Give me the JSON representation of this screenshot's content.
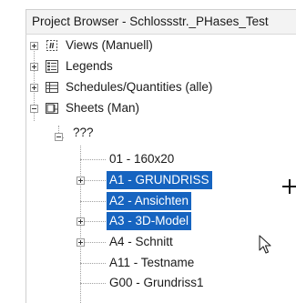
{
  "panel": {
    "title": "Project Browser - Schlossstr._PHases_Test"
  },
  "tree": {
    "views": {
      "label": "Views (Manuell)",
      "icon": "views-icon",
      "expander": "plus"
    },
    "legends": {
      "label": "Legends",
      "icon": "legends-icon",
      "expander": "plus"
    },
    "schedules": {
      "label": "Schedules/Quantities (alle)",
      "icon": "schedules-icon",
      "expander": "plus"
    },
    "sheets": {
      "label": "Sheets (Man)",
      "icon": "sheets-icon",
      "expander": "minus",
      "group": {
        "label": "???",
        "expander": "minus",
        "items": [
          {
            "label": "01 - 160x20",
            "selected": false,
            "expander": "none"
          },
          {
            "label": "A1 - GRUNDRISS",
            "selected": true,
            "expander": "plus"
          },
          {
            "label": "A2 - Ansichten",
            "selected": true,
            "expander": "none"
          },
          {
            "label": "A3 - 3D-Model",
            "selected": true,
            "expander": "plus"
          },
          {
            "label": "A4 - Schnitt",
            "selected": false,
            "expander": "plus"
          },
          {
            "label": "A11 - Testname",
            "selected": false,
            "expander": "none"
          },
          {
            "label": "G00 - Grundriss1",
            "selected": false,
            "expander": "none"
          }
        ]
      }
    }
  },
  "colors": {
    "selection": "#1664c0",
    "selection_text": "#ffffff"
  }
}
